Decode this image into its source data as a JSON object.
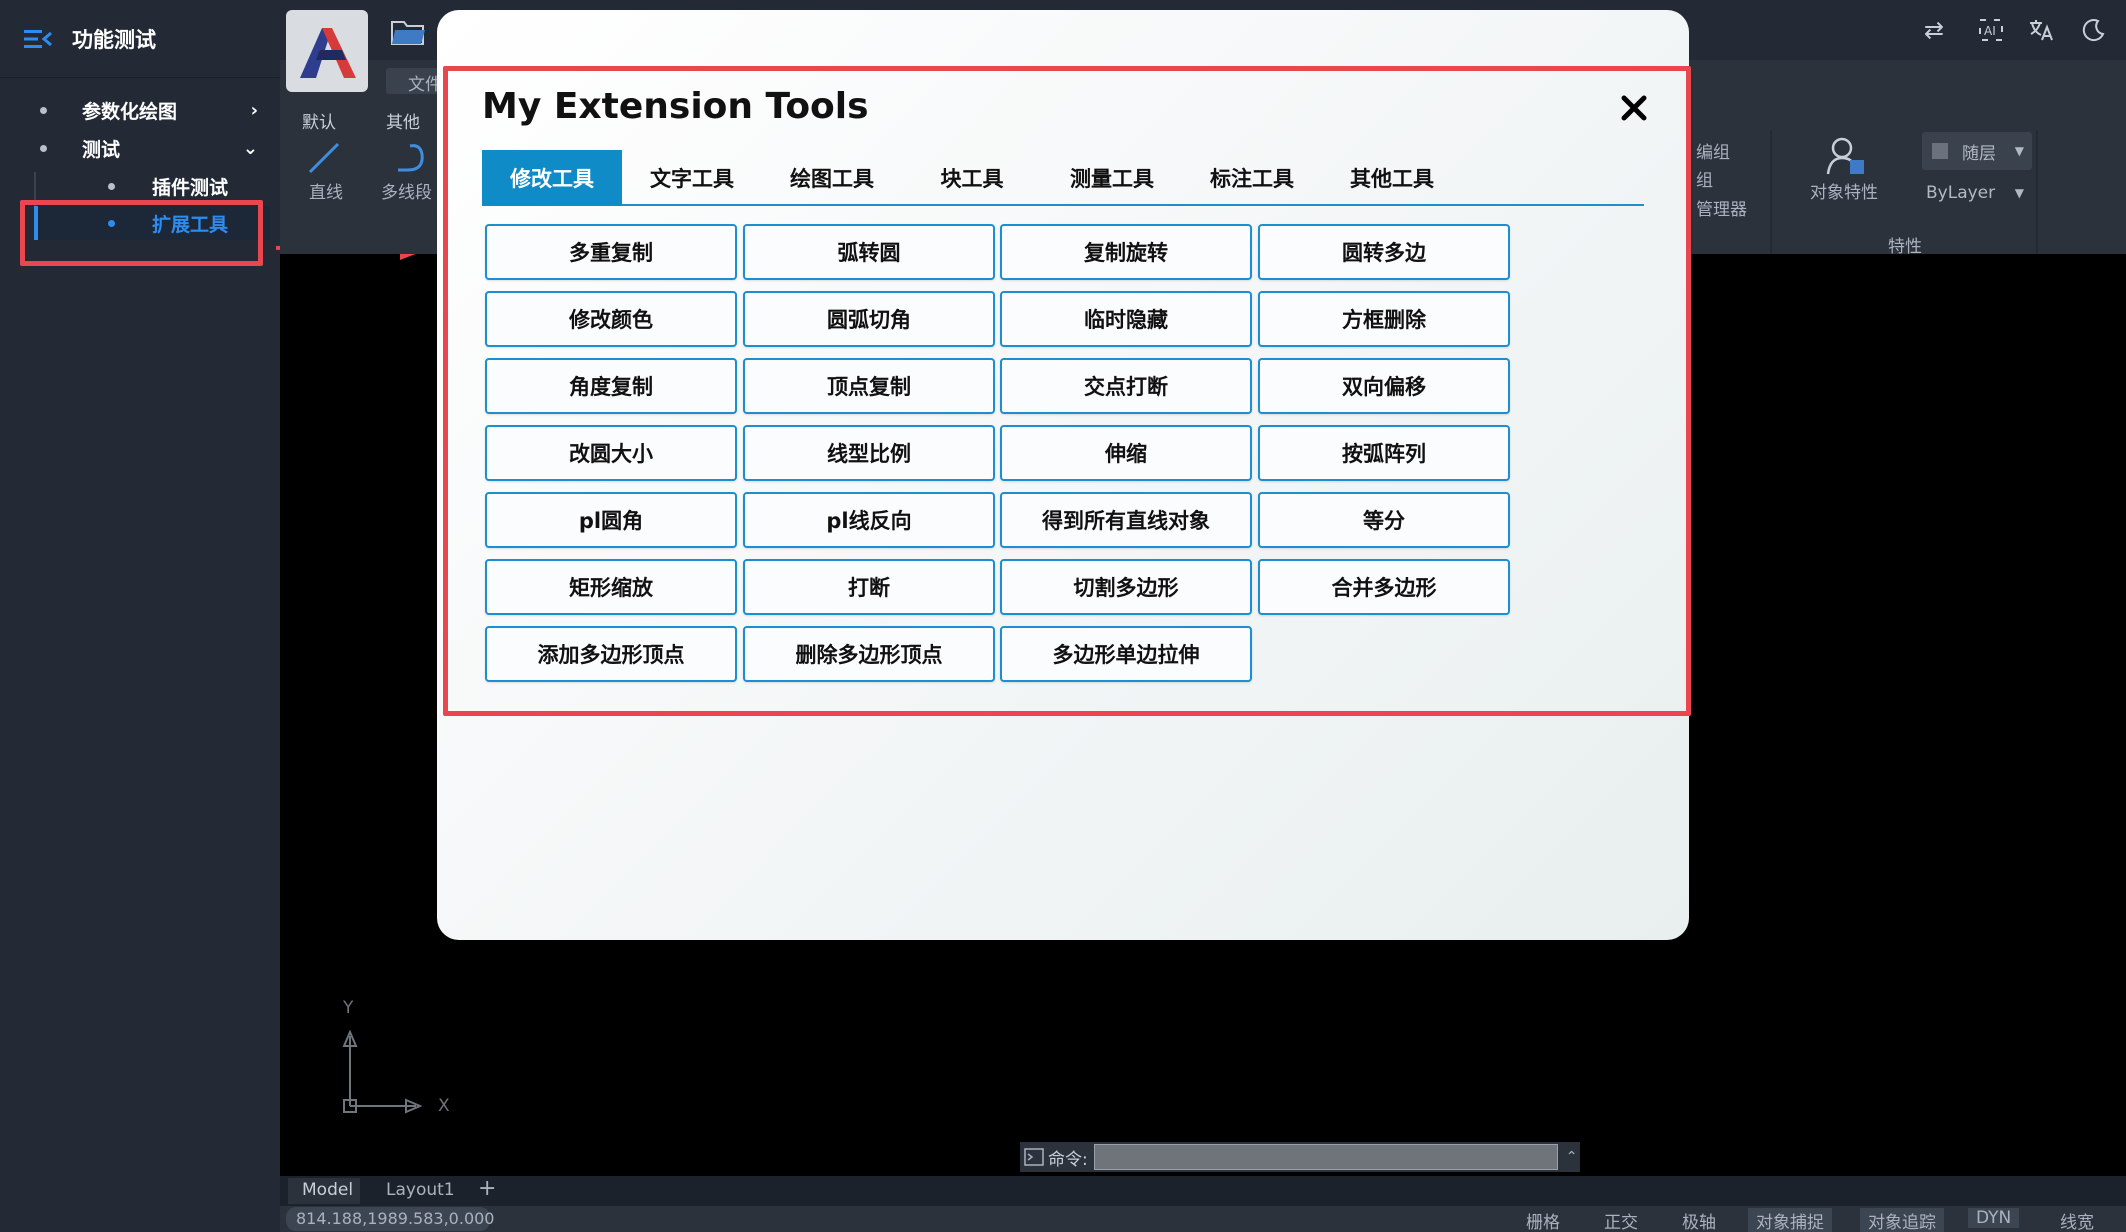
{
  "sidebar": {
    "title": "功能测试",
    "items": [
      {
        "label": "参数化绘图"
      },
      {
        "label": "测试"
      },
      {
        "label": "插件测试"
      },
      {
        "label": "扩展工具"
      }
    ]
  },
  "toolbar": {
    "file_label": "文件",
    "tabs": [
      "默认",
      "其他"
    ],
    "tools": [
      "直线",
      "多线段"
    ],
    "group_labels": [
      "编组",
      "组",
      "管理器"
    ],
    "object_props": "对象特性",
    "layer_select": "随层",
    "linetype_select": "ByLayer",
    "props_section": "特性"
  },
  "dialog": {
    "title": "My Extension Tools",
    "close_symbol": "✕",
    "tabs": [
      "修改工具",
      "文字工具",
      "绘图工具",
      "块工具",
      "测量工具",
      "标注工具",
      "其他工具"
    ],
    "active_tab": 0,
    "buttons": [
      "多重复制",
      "弧转圆",
      "复制旋转",
      "圆转多边",
      "修改颜色",
      "圆弧切角",
      "临时隐藏",
      "方框删除",
      "角度复制",
      "顶点复制",
      "交点打断",
      "双向偏移",
      "改圆大小",
      "线型比例",
      "伸缩",
      "按弧阵列",
      "pl圆角",
      "pl线反向",
      "得到所有直线对象",
      "等分",
      "矩形缩放",
      "打断",
      "切割多边形",
      "合并多边形",
      "添加多边形顶点",
      "删除多边形顶点",
      "多边形单边拉伸"
    ]
  },
  "canvas": {
    "axis_y": "Y",
    "axis_x": "X",
    "cmd_label": "命令:",
    "layout_tabs": [
      "Model",
      "Layout1"
    ],
    "add_tab": "+",
    "coords": "814.188,1989.583,0.000"
  },
  "status": {
    "items": [
      "栅格",
      "正交",
      "极轴",
      "对象捕捉",
      "对象追踪",
      "DYN",
      "线宽"
    ]
  },
  "colors": {
    "accent": "#0f8bc7",
    "button_border": "#1d8ecf",
    "highlight_red": "#e9464f",
    "sidebar_bg": "#232a35"
  }
}
